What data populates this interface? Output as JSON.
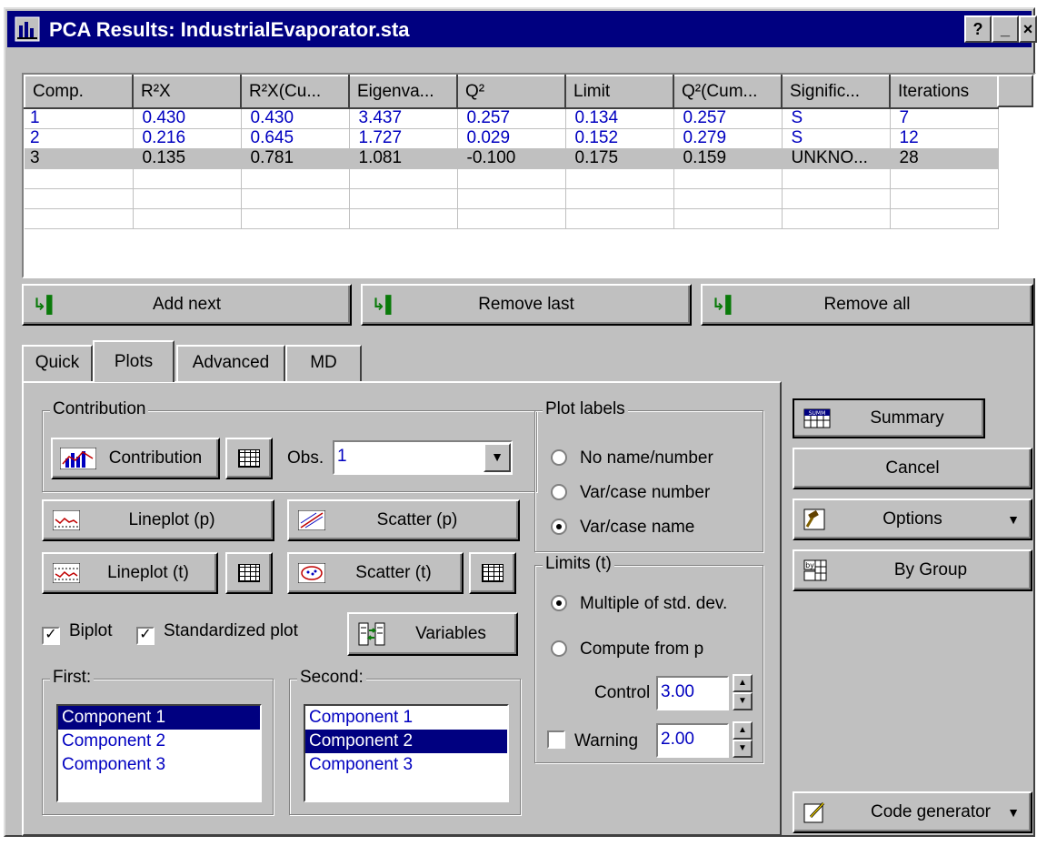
{
  "window": {
    "title": "PCA Results: IndustrialEvaporator.sta",
    "help_btn": "?",
    "min_btn": "_",
    "close_btn": "×"
  },
  "grid": {
    "columns": [
      "Comp.",
      "R²X",
      "R²X(Cu...",
      "Eigenva...",
      "Q²",
      "Limit",
      "Q²(Cum...",
      "Signific...",
      "Iterations"
    ],
    "rows": [
      [
        "1",
        "0.430",
        "0.430",
        "3.437",
        "0.257",
        "0.134",
        "0.257",
        "S",
        "7"
      ],
      [
        "2",
        "0.216",
        "0.645",
        "1.727",
        "0.029",
        "0.152",
        "0.279",
        "S",
        "12"
      ],
      [
        "3",
        "0.135",
        "0.781",
        "1.081",
        "-0.100",
        "0.175",
        "0.159",
        "UNKNO...",
        "28"
      ]
    ],
    "selected_row": 2
  },
  "actions": {
    "add_next": "Add next",
    "remove_last": "Remove last",
    "remove_all": "Remove all"
  },
  "tabs": [
    "Quick",
    "Plots",
    "Advanced",
    "MD"
  ],
  "active_tab": "Plots",
  "contribution": {
    "group_label": "Contribution",
    "button": "Contribution",
    "obs_label": "Obs.",
    "obs_value": "1"
  },
  "plot_buttons": {
    "lineplot_p": "Lineplot (p)",
    "scatter_p": "Scatter (p)",
    "lineplot_t": "Lineplot (t)",
    "scatter_t": "Scatter (t)",
    "variables": "Variables"
  },
  "checks": {
    "biplot": "Biplot",
    "biplot_checked": true,
    "standardized": "Standardized plot",
    "standardized_checked": true
  },
  "first": {
    "label": "First:",
    "items": [
      "Component 1",
      "Component 2",
      "Component 3"
    ],
    "selected": 0
  },
  "second": {
    "label": "Second:",
    "items": [
      "Component 1",
      "Component 2",
      "Component 3"
    ],
    "selected": 1
  },
  "plot_labels": {
    "label": "Plot labels",
    "options": [
      "No name/number",
      "Var/case number",
      "Var/case name"
    ],
    "selected": 2
  },
  "limits": {
    "label": "Limits (t)",
    "options": [
      "Multiple of std. dev.",
      "Compute from p"
    ],
    "selected": 0,
    "control_label": "Control",
    "control_value": "3.00",
    "warning_label": "Warning",
    "warning_value": "2.00",
    "warning_checked": false
  },
  "side": {
    "summary": "Summary",
    "cancel": "Cancel",
    "options": "Options",
    "by_group": "By Group",
    "code_generator": "Code generator"
  },
  "colors": {
    "face": "#c0c0c0",
    "title_bar": "#000080",
    "value_text": "#0000c0"
  }
}
